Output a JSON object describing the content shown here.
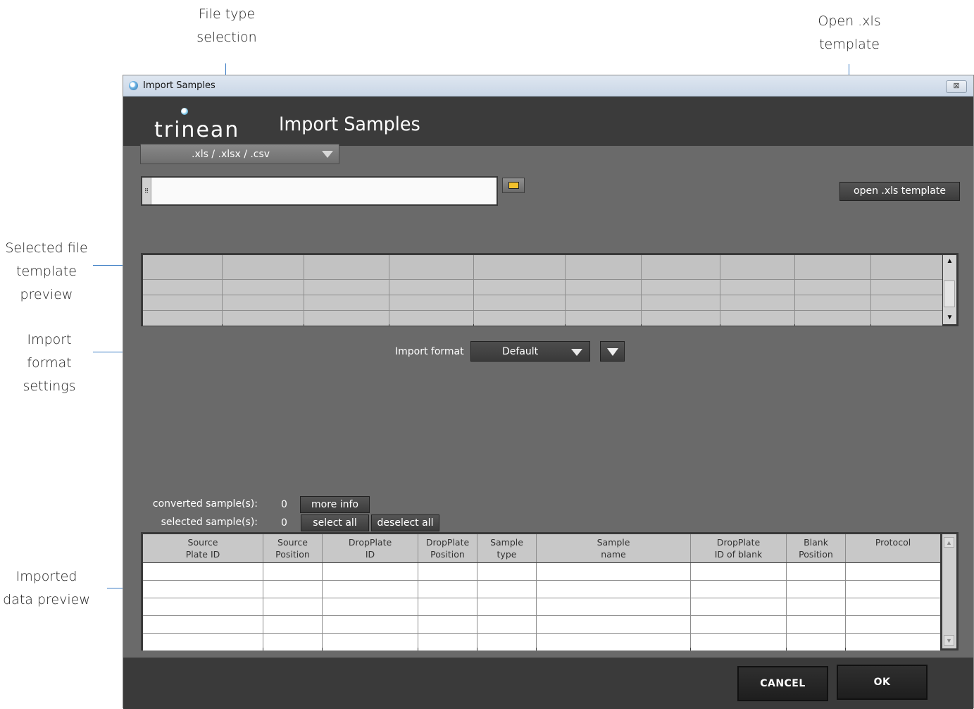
{
  "callouts": {
    "file_type": [
      "File type",
      "selection"
    ],
    "open_xls": [
      "Open .xls",
      "template"
    ],
    "template_preview": [
      "Selected file",
      "template",
      "preview"
    ],
    "import_format": [
      "Import",
      "format",
      "settings"
    ],
    "imported_data": [
      "Imported",
      "data preview"
    ]
  },
  "window": {
    "title": "Import Samples",
    "close_glyph": "⊠",
    "logo_text": "trinean",
    "header_title": "Import Samples"
  },
  "file_type_select": {
    "value": ".xls / .xlsx / .csv"
  },
  "path_field": {
    "value": "",
    "grip": "⠿"
  },
  "open_template_button": "open .xls template",
  "import_format": {
    "label": "Import format",
    "value": "Default"
  },
  "counts": {
    "converted_label": "converted sample(s):",
    "converted_value": "0",
    "selected_label": "selected sample(s):",
    "selected_value": "0",
    "more_info": "more info",
    "select_all": "select all",
    "deselect_all": "deselect all"
  },
  "data_table": {
    "columns": [
      "Source\nPlate ID",
      "Source\nPosition",
      "DropPlate\nID",
      "DropPlate\nPosition",
      "Sample\ntype",
      "Sample\nname",
      "DropPlate\nID of blank",
      "Blank\nPosition",
      "Protocol"
    ],
    "rows": 5
  },
  "scroll_glyphs": {
    "up": "▲",
    "down": "▼"
  },
  "footer": {
    "cancel": "CANCEL",
    "ok": "OK"
  },
  "colors": {
    "accent_line": "#3b7cc4",
    "window_bg": "#6a6a6a",
    "header_bg": "#3b3b3b"
  }
}
